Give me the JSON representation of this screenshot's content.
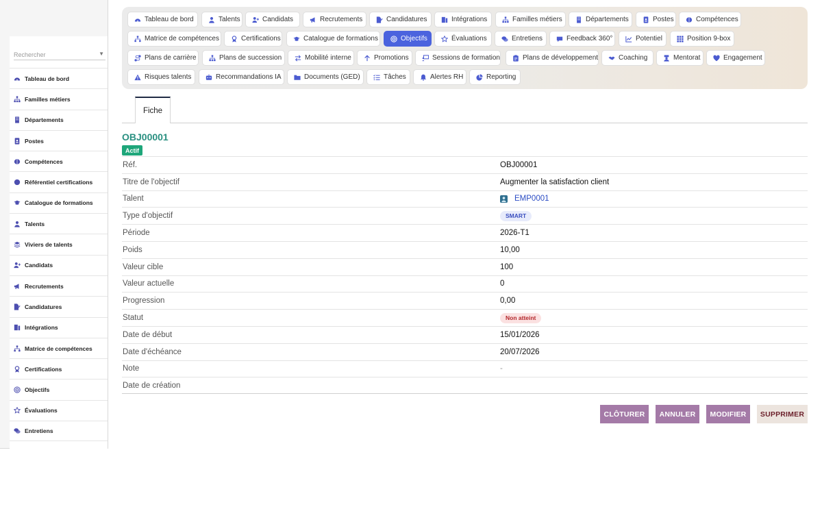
{
  "colors": {
    "accent": "#4b63de",
    "title_teal": "#2a9081",
    "badge_green": "#1ea67a",
    "button_purple": "#a47aa7",
    "button_light": "#ece4de",
    "link_blue": "#2b4cc4"
  },
  "sidebar": {
    "search_placeholder": "Rechercher",
    "items": [
      {
        "label": "Tableau de bord",
        "icon": "dashboard-icon"
      },
      {
        "label": "Familles métiers",
        "icon": "sitemap-icon"
      },
      {
        "label": "Départements",
        "icon": "building-icon"
      },
      {
        "label": "Postes",
        "icon": "id-badge-icon"
      },
      {
        "label": "Compétences",
        "icon": "brain-icon"
      },
      {
        "label": "Référentiel certifications",
        "icon": "certificate-icon"
      },
      {
        "label": "Catalogue de formations",
        "icon": "graduation-cap-icon"
      },
      {
        "label": "Talents",
        "icon": "user-icon"
      },
      {
        "label": "Viviers de talents",
        "icon": "layers-icon"
      },
      {
        "label": "Candidats",
        "icon": "user-plus-icon"
      },
      {
        "label": "Recrutements",
        "icon": "megaphone-icon"
      },
      {
        "label": "Candidatures",
        "icon": "file-signature-icon"
      },
      {
        "label": "Intégrations",
        "icon": "door-icon"
      },
      {
        "label": "Matrice de compétences",
        "icon": "network-icon"
      },
      {
        "label": "Certifications",
        "icon": "award-icon"
      },
      {
        "label": "Objectifs",
        "icon": "target-icon"
      },
      {
        "label": "Évaluations",
        "icon": "star-icon"
      },
      {
        "label": "Entretiens",
        "icon": "chat-icon"
      }
    ]
  },
  "topnav": {
    "items": [
      {
        "label": "Tableau de bord",
        "icon": "dashboard-icon"
      },
      {
        "label": "Talents",
        "icon": "user-icon"
      },
      {
        "label": "Candidats",
        "icon": "user-plus-icon"
      },
      {
        "label": "Recrutements",
        "icon": "megaphone-icon"
      },
      {
        "label": "Candidatures",
        "icon": "file-signature-icon"
      },
      {
        "label": "Intégrations",
        "icon": "door-icon"
      },
      {
        "label": "Familles métiers",
        "icon": "sitemap-icon"
      },
      {
        "label": "Départements",
        "icon": "building-icon"
      },
      {
        "label": "Postes",
        "icon": "id-badge-icon"
      },
      {
        "label": "Compétences",
        "icon": "brain-icon"
      },
      {
        "label": "Matrice de compétences",
        "icon": "network-icon"
      },
      {
        "label": "Certifications",
        "icon": "award-icon"
      },
      {
        "label": "Catalogue de formations",
        "icon": "graduation-cap-icon"
      },
      {
        "label": "Objectifs",
        "icon": "target-icon",
        "active": true
      },
      {
        "label": "Évaluations",
        "icon": "star-icon"
      },
      {
        "label": "Entretiens",
        "icon": "chat-icon"
      },
      {
        "label": "Feedback 360°",
        "icon": "comment-icon"
      },
      {
        "label": "Potentiel",
        "icon": "chart-line-icon"
      },
      {
        "label": "Position 9-box",
        "icon": "grid-icon"
      },
      {
        "label": "Plans de carrière",
        "icon": "route-icon"
      },
      {
        "label": "Plans de succession",
        "icon": "sitemap-icon"
      },
      {
        "label": "Mobilité interne",
        "icon": "exchange-icon"
      },
      {
        "label": "Promotions",
        "icon": "arrow-up-icon"
      },
      {
        "label": "Sessions de formation",
        "icon": "presentation-icon"
      },
      {
        "label": "Plans de développement",
        "icon": "clipboard-icon"
      },
      {
        "label": "Coaching",
        "icon": "handshake-icon"
      },
      {
        "label": "Mentorat",
        "icon": "mentor-icon"
      },
      {
        "label": "Engagement",
        "icon": "heart-icon"
      },
      {
        "label": "Risques talents",
        "icon": "warning-icon"
      },
      {
        "label": "Recommandations IA",
        "icon": "robot-icon"
      },
      {
        "label": "Documents (GED)",
        "icon": "folder-icon"
      },
      {
        "label": "Tâches",
        "icon": "tasks-icon"
      },
      {
        "label": "Alertes RH",
        "icon": "bell-icon"
      },
      {
        "label": "Reporting",
        "icon": "pie-chart-icon"
      }
    ]
  },
  "tabs": [
    {
      "label": "Fiche"
    }
  ],
  "record": {
    "title": "OBJ00001",
    "badge": "Actif",
    "fields": [
      {
        "label": "Réf.",
        "value": "OBJ00001",
        "kind": "text"
      },
      {
        "label": "Titre de l'objectif",
        "value": "Augmenter la satisfaction client",
        "kind": "text"
      },
      {
        "label": "Talent",
        "value": "EMP0001",
        "kind": "link"
      },
      {
        "label": "Type d'objectif",
        "value": "SMART",
        "kind": "chip-smart"
      },
      {
        "label": "Période",
        "value": "2026-T1",
        "kind": "text"
      },
      {
        "label": "Poids",
        "value": "10,00",
        "kind": "text"
      },
      {
        "label": "Valeur cible",
        "value": "100",
        "kind": "text"
      },
      {
        "label": "Valeur actuelle",
        "value": "0",
        "kind": "text"
      },
      {
        "label": "Progression",
        "value": "0,00",
        "kind": "text"
      },
      {
        "label": "Statut",
        "value": "Non atteint",
        "kind": "chip-status"
      },
      {
        "label": "Date de début",
        "value": "15/01/2026",
        "kind": "text"
      },
      {
        "label": "Date d'échéance",
        "value": "20/07/2026",
        "kind": "text"
      },
      {
        "label": "Note",
        "value": "-",
        "kind": "muted"
      },
      {
        "label": "Date de création",
        "value": "",
        "kind": "text"
      }
    ]
  },
  "actions": {
    "cloturer": "CLÔTURER",
    "annuler": "ANNULER",
    "modifier": "MODIFIER",
    "supprimer": "SUPPRIMER"
  }
}
